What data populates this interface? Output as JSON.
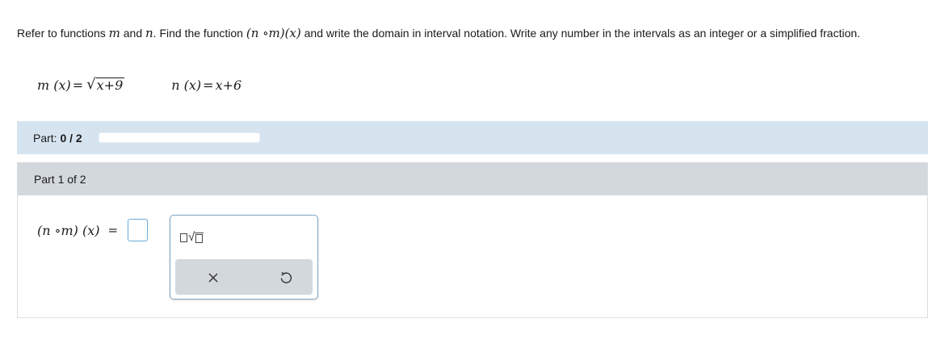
{
  "question": {
    "text_1": "Refer to functions ",
    "var_m": "m",
    "text_2": " and ",
    "var_n": "n",
    "text_3": ". Find the function ",
    "composition": "(n ∘m)(x)",
    "text_4": " and write the domain in interval notation. Write any number in the intervals as an integer or a simplified fraction."
  },
  "functions": {
    "m_lhs": "m (x)",
    "m_eq": "=",
    "m_radicand": "x+9",
    "n_lhs": "n (x)",
    "n_eq": "=",
    "n_rhs": "x+6"
  },
  "progress": {
    "label": "Part: ",
    "value": "0 / 2",
    "fraction": 0
  },
  "part": {
    "header": "Part 1 of 2",
    "answer_lhs": "(n  ∘m) (x)",
    "answer_eq": "="
  },
  "palette": {
    "tool_icon": "root-template-icon",
    "clear_icon": "close-icon",
    "undo_icon": "undo-icon"
  },
  "colors": {
    "progress_bg": "#d6e4f0",
    "part_header_bg": "#d3d8dd",
    "answer_box_border": "#6aa9d8"
  }
}
